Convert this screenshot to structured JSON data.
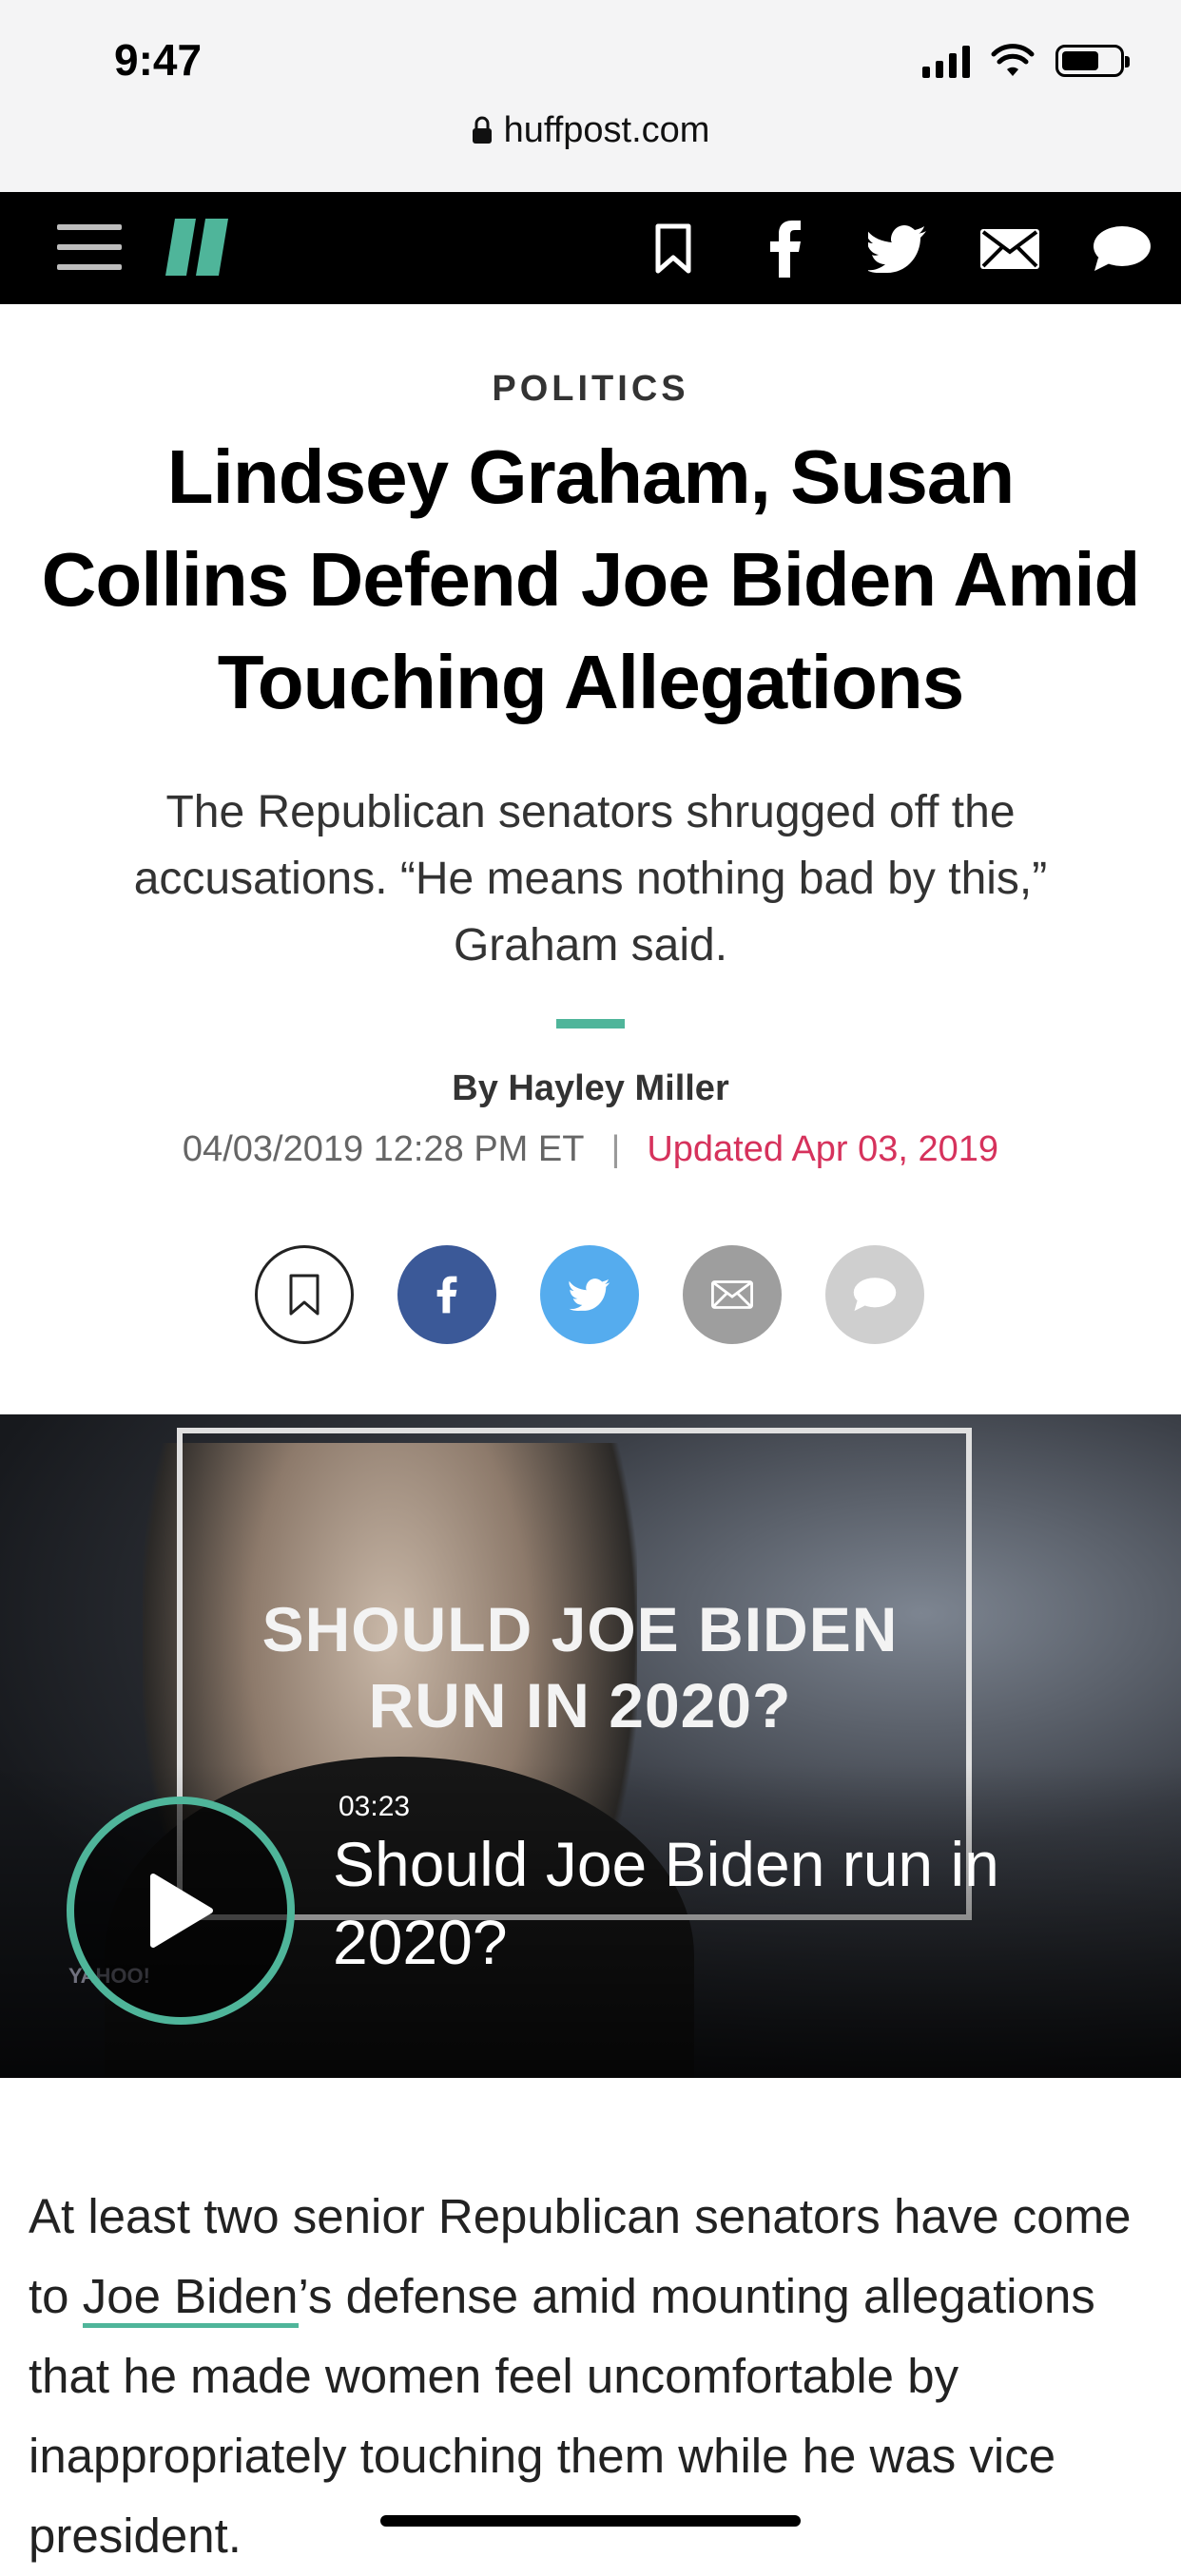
{
  "status_bar": {
    "time": "9:47"
  },
  "browser": {
    "url": "huffpost.com"
  },
  "nav": {
    "menu_icon": "hamburger-icon",
    "logo": "huffpost-logo",
    "icons": [
      "bookmark-icon",
      "facebook-icon",
      "twitter-icon",
      "email-icon",
      "comment-icon"
    ]
  },
  "article": {
    "kicker": "POLITICS",
    "headline": "Lindsey Graham, Susan Collins Defend Joe Biden Amid Touching Allegations",
    "subhead": "The Republican senators shrugged off the accusations. “He means nothing bad by this,” Graham said.",
    "byline": "By Hayley Miller",
    "published": "04/03/2019 12:28 PM ET",
    "separator": "|",
    "updated": "Updated Apr 03, 2019",
    "body_before_link": "At least two senior Republican senators have come to ",
    "body_link": "Joe Biden",
    "body_after_link": "’s defense amid mounting allegations that he made women feel uncomfortable by inappropriately touching them while he was vice president."
  },
  "video": {
    "overlay_title": "SHOULD JOE BIDEN RUN IN 2020?",
    "duration": "03:23",
    "caption": "Should Joe Biden run in 2020?",
    "watermark": "YAHOO!"
  },
  "colors": {
    "accent": "#4fb59a",
    "updated": "#d6325c",
    "facebook": "#3b5998",
    "twitter": "#55acee",
    "email": "#9e9e9e",
    "comment": "#cfcfcf",
    "navbar": "#000000"
  }
}
